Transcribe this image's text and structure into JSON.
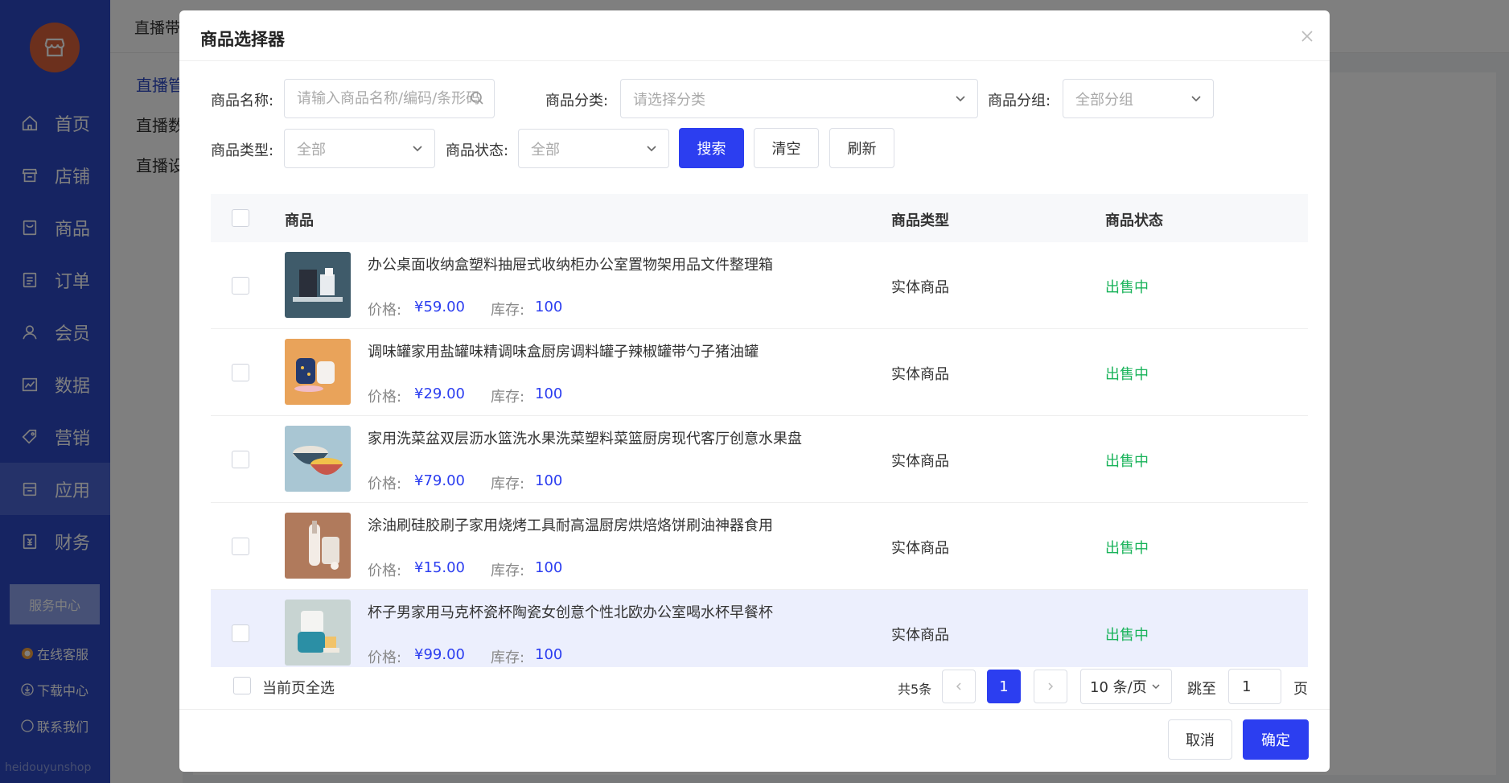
{
  "app": {
    "topbar_title": "直播带",
    "watermark": "heidouyunshop",
    "service_center": "服务中心",
    "side_links": [
      "在线客服",
      "下载中心",
      "联系我们"
    ],
    "nav": [
      {
        "label": "首页",
        "icon": "home-icon"
      },
      {
        "label": "店铺",
        "icon": "shop-icon"
      },
      {
        "label": "商品",
        "icon": "goods-icon"
      },
      {
        "label": "订单",
        "icon": "order-icon"
      },
      {
        "label": "会员",
        "icon": "member-icon"
      },
      {
        "label": "数据",
        "icon": "chart-icon"
      },
      {
        "label": "营销",
        "icon": "tag-icon"
      },
      {
        "label": "应用",
        "icon": "app-icon",
        "active": true
      },
      {
        "label": "财务",
        "icon": "finance-icon"
      }
    ],
    "subnav": [
      "直播管",
      "直播数",
      "直播设"
    ]
  },
  "modal": {
    "title": "商品选择器",
    "filters": {
      "name_label": "商品名称:",
      "name_placeholder": "请输入商品名称/编码/条形码",
      "category_label": "商品分类:",
      "category_placeholder": "请选择分类",
      "group_label": "商品分组:",
      "group_value": "全部分组",
      "type_label": "商品类型:",
      "type_value": "全部",
      "status_label": "商品状态:",
      "status_value": "全部",
      "search_btn": "搜索",
      "clear_btn": "清空",
      "refresh_btn": "刷新"
    },
    "table": {
      "headers": {
        "product": "商品",
        "type": "商品类型",
        "status": "商品状态"
      },
      "price_label": "价格:",
      "stock_label": "库存:",
      "rows": [
        {
          "name": "办公桌面收纳盒塑料抽屉式收纳柜办公室置物架用品文件整理箱",
          "price": "¥59.00",
          "stock": "100",
          "type": "实体商品",
          "status": "出售中"
        },
        {
          "name": "调味罐家用盐罐味精调味盒厨房调料罐子辣椒罐带勺子猪油罐",
          "price": "¥29.00",
          "stock": "100",
          "type": "实体商品",
          "status": "出售中"
        },
        {
          "name": "家用洗菜盆双层沥水篮洗水果洗菜塑料菜篮厨房现代客厅创意水果盘",
          "price": "¥79.00",
          "stock": "100",
          "type": "实体商品",
          "status": "出售中"
        },
        {
          "name": "涂油刷硅胶刷子家用烧烤工具耐高温厨房烘焙烙饼刷油神器食用",
          "price": "¥15.00",
          "stock": "100",
          "type": "实体商品",
          "status": "出售中"
        },
        {
          "name": "杯子男家用马克杯瓷杯陶瓷女创意个性北欧办公室喝水杯早餐杯",
          "price": "¥99.00",
          "stock": "100",
          "type": "实体商品",
          "status": "出售中"
        }
      ]
    },
    "select_all": "当前页全选",
    "pagination": {
      "total": "共5条",
      "current_page": "1",
      "page_size": "10 条/页",
      "jump_label": "跳至",
      "jump_value": "1",
      "page_suffix": "页"
    },
    "footer": {
      "cancel": "取消",
      "confirm": "确定"
    }
  }
}
